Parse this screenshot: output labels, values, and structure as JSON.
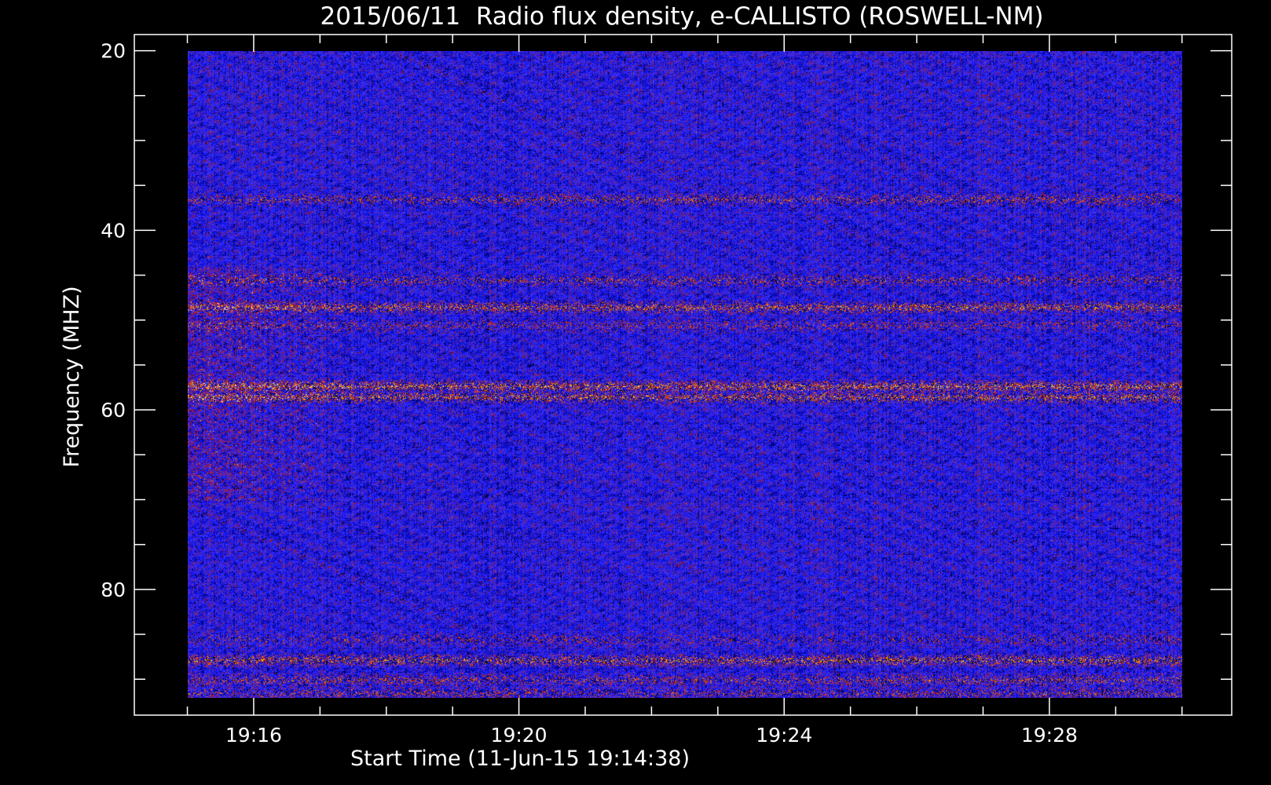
{
  "chart_data": {
    "type": "heatmap",
    "title": "2015/06/11  Radio flux density, e-CALLISTO (ROSWELL-NM)",
    "xlabel": "Start Time (11-Jun-15 19:14:38)",
    "ylabel": "Frequency (MHZ)",
    "x_ticks": [
      "19:16",
      "19:20",
      "19:24",
      "19:28"
    ],
    "x_tick_minutes": [
      16,
      20,
      24,
      28
    ],
    "x_minor_tick_minutes": [
      15,
      16,
      17,
      18,
      19,
      20,
      21,
      22,
      23,
      24,
      25,
      26,
      27,
      28,
      29,
      30
    ],
    "xlim_minutes": [
      14.2,
      30.75
    ],
    "data_x_range_minutes": [
      15.0,
      30.0
    ],
    "y_ticks": [
      20,
      40,
      60,
      80
    ],
    "y_minor_ticks": [
      20,
      25,
      30,
      35,
      40,
      45,
      50,
      55,
      60,
      65,
      70,
      75,
      80,
      85,
      90
    ],
    "ylim": [
      18.2,
      94.0
    ],
    "data_y_range": [
      20,
      92
    ],
    "y_inverted": true,
    "colormap": [
      "#000000",
      "#00008a",
      "#1414ff",
      "#3a3aff",
      "#8a1030",
      "#d01010",
      "#ff6a00",
      "#ffd000",
      "#ffffff"
    ],
    "emission_lanes_mhz": [
      {
        "freq": 36.5,
        "strength": 0.6
      },
      {
        "freq": 45.5,
        "strength": 0.55
      },
      {
        "freq": 48.5,
        "strength": 0.85
      },
      {
        "freq": 50.5,
        "strength": 0.45
      },
      {
        "freq": 57.3,
        "strength": 1.0
      },
      {
        "freq": 58.5,
        "strength": 0.9
      },
      {
        "freq": 85.5,
        "strength": 0.4
      },
      {
        "freq": 87.8,
        "strength": 0.85
      },
      {
        "freq": 90.0,
        "strength": 0.6
      },
      {
        "freq": 91.5,
        "strength": 0.55
      }
    ],
    "burst_region": {
      "time_minutes": [
        15.0,
        17.5
      ],
      "freq_mhz": [
        44,
        70
      ],
      "strength": 0.6
    }
  }
}
